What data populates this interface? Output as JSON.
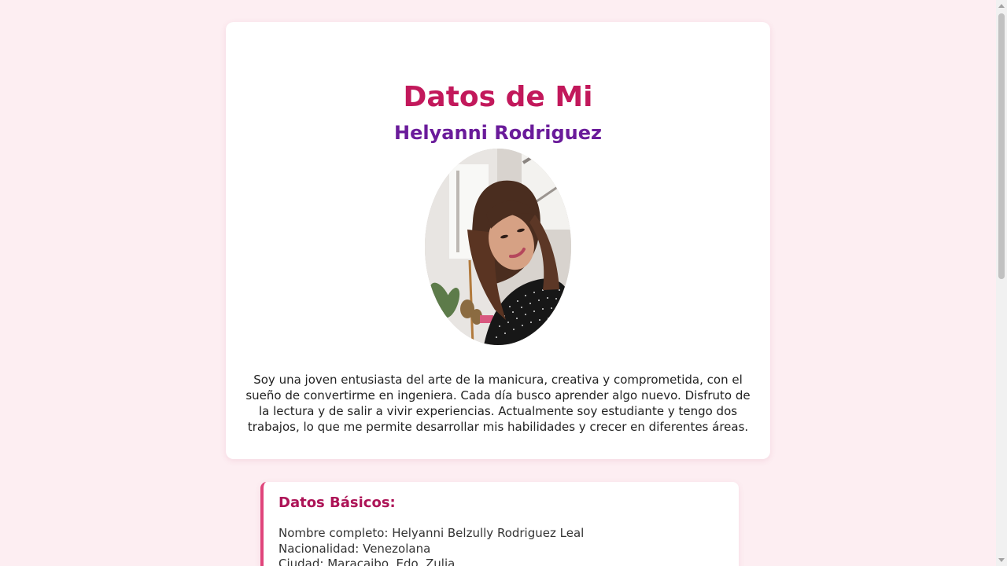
{
  "profile": {
    "title": "Datos de Mi",
    "name": "Helyanni Rodriguez",
    "bio": "Soy una joven entusiasta del arte de la manicura, creativa y comprometida, con el sueño de convertirme en ingeniera. Cada día busco aprender algo nuevo. Disfruto de la lectura y de salir a vivir experiencias. Actualmente soy estudiante y tengo dos trabajos, lo que me permite desarrollar mis habilidades y crecer en diferentes áreas."
  },
  "basics": {
    "title": "Datos Básicos:",
    "lines": [
      "Nombre completo: Helyanni Belzully Rodriguez Leal",
      "Nacionalidad: Venezolana",
      "Ciudad: Maracaibo, Edo. Zulia"
    ]
  },
  "colors": {
    "background": "#fdeef2",
    "title": "#c2185b",
    "name": "#6a1b9a",
    "accent_border": "#e0457b",
    "section_title": "#ad1457"
  },
  "icons": {
    "scroll_up": "scroll-up-arrow-icon",
    "scroll_down": "scroll-down-arrow-icon"
  }
}
